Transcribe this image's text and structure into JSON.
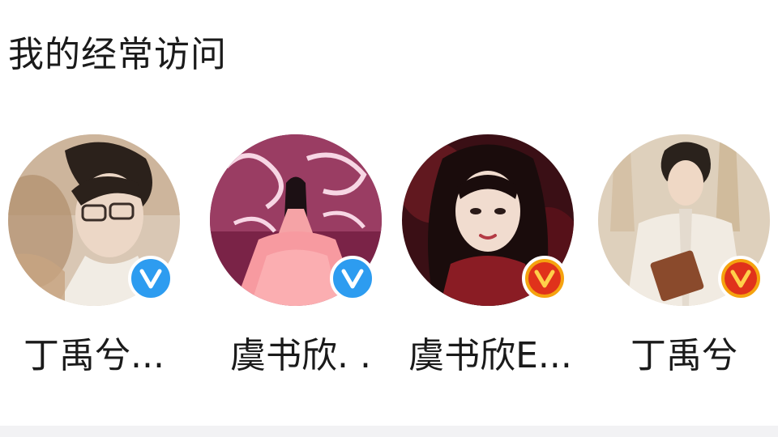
{
  "section": {
    "title": "我的经常访问"
  },
  "visits": [
    {
      "name": "丁禹兮...",
      "badge_icon": "verified-v-icon",
      "badge_color": "#2d9cf0"
    },
    {
      "name": "虞书欣. .",
      "badge_icon": "verified-v-icon",
      "badge_color": "#2d9cf0"
    },
    {
      "name": "虞书欣E...",
      "badge_icon": "verified-v-icon",
      "badge_color": "#e0321b"
    },
    {
      "name": "丁禹兮",
      "badge_icon": "verified-v-icon",
      "badge_color": "#e0321b"
    }
  ]
}
